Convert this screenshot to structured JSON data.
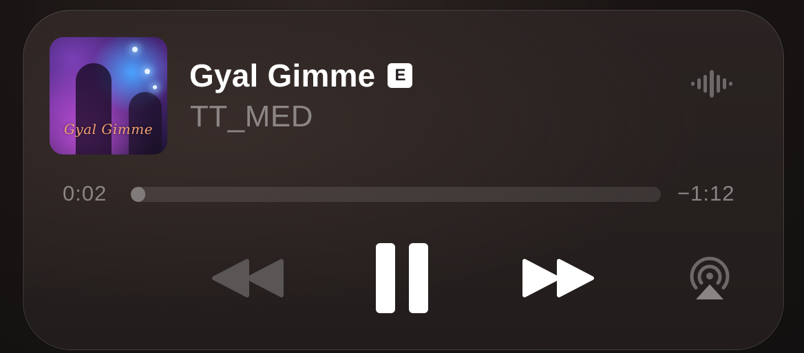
{
  "now_playing": {
    "track_title": "Gyal Gimme",
    "explicit_badge": "E",
    "artist": "TT_MED",
    "artwork_text": "Gyal Gimme"
  },
  "progress": {
    "elapsed": "0:02",
    "remaining": "−1:12",
    "fraction": 0.027
  },
  "controls": {
    "previous": "rewind-icon",
    "play_pause": "pause-icon",
    "next": "fast-forward-icon",
    "output": "airplay-icon",
    "audio_indicator": "waveform-icon"
  },
  "colors": {
    "title": "#ffffff",
    "secondary_text": "#8c8786",
    "disabled_control": "#5a5655",
    "active_control": "#ffffff"
  }
}
